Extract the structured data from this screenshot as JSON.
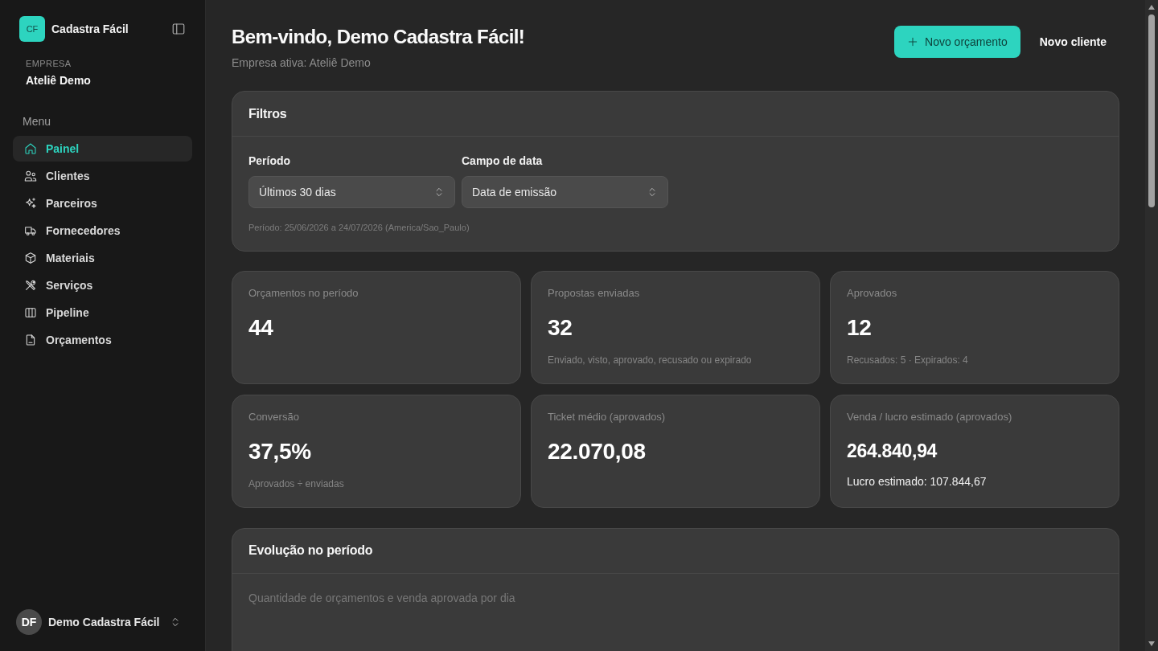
{
  "sidebar": {
    "brand": {
      "initials": "CF",
      "name": "Cadastra Fácil"
    },
    "company": {
      "label": "EMPRESA",
      "name": "Ateliê Demo"
    },
    "menu_title": "Menu",
    "items": [
      {
        "label": "Painel",
        "selected": true
      },
      {
        "label": "Clientes",
        "selected": false
      },
      {
        "label": "Parceiros",
        "selected": false
      },
      {
        "label": "Fornecedores",
        "selected": false
      },
      {
        "label": "Materiais",
        "selected": false
      },
      {
        "label": "Serviços",
        "selected": false
      },
      {
        "label": "Pipeline",
        "selected": false
      },
      {
        "label": "Orçamentos",
        "selected": false
      }
    ],
    "user": {
      "initials": "DF",
      "name": "Demo Cadastra Fácil"
    }
  },
  "header": {
    "title": "Bem-vindo, Demo Cadastra Fácil!",
    "subtitle": "Empresa ativa: Ateliê Demo",
    "actions": [
      {
        "label": "Novo orçamento",
        "kind": "primary"
      },
      {
        "label": "Novo cliente",
        "kind": "ghost"
      }
    ]
  },
  "filters": {
    "title": "Filtros",
    "fields": [
      {
        "label": "Período",
        "value": "Últimos 30 dias"
      },
      {
        "label": "Campo de data",
        "value": "Data de emissão"
      }
    ],
    "note": "Período: 25/06/2026 a 24/07/2026 (America/Sao_Paulo)"
  },
  "stats": [
    {
      "kind": "basic",
      "label": "Orçamentos no período",
      "value": "44"
    },
    {
      "kind": "basic",
      "label": "Propostas enviadas",
      "value": "32",
      "note": "Enviado, visto, aprovado, recusado ou expirado"
    },
    {
      "kind": "basic",
      "label": "Aprovados",
      "value": "12",
      "note": "Recusados: 5 · Expirados: 4"
    },
    {
      "kind": "basic",
      "label": "Conversão",
      "value": "37,5%",
      "note": "Aprovados ÷ enviadas"
    },
    {
      "kind": "basic",
      "label": "Ticket médio (aprovados)",
      "value": "22.070,08"
    },
    {
      "kind": "detail",
      "label": "Venda / lucro estimado (aprovados)",
      "value": "264.840,94",
      "note": "Lucro estimado: 107.844,67"
    }
  ],
  "evolution": {
    "title": "Evolução no período",
    "subtitle": "Quantidade de orçamentos e venda aprovada por dia"
  }
}
